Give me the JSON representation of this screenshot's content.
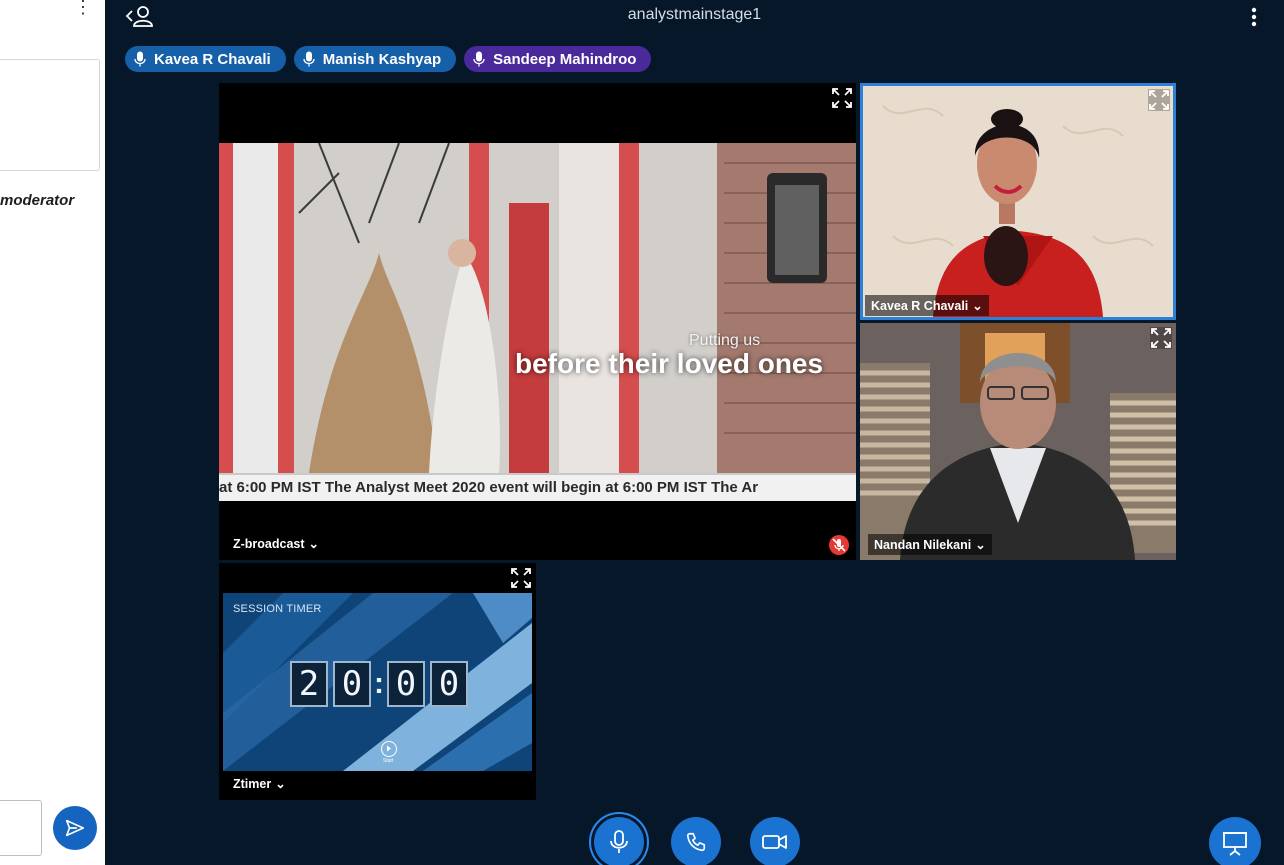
{
  "left_panel": {
    "moderator_text": "moderator",
    "menu_icon": "more-vertical-icon",
    "send_icon": "send-icon"
  },
  "header": {
    "title": "analystmainstage1",
    "back_icon": "back-user-icon",
    "menu_icon": "more-vertical-icon"
  },
  "speakers": [
    {
      "name": "Kavea R Chavali",
      "color": "#1560a8"
    },
    {
      "name": "Manish Kashyap",
      "color": "#1560a8"
    },
    {
      "name": "Sandeep Mahindroo",
      "color": "#4a2a9a"
    }
  ],
  "tiles": {
    "broadcast": {
      "label": "Z-broadcast",
      "overlay_small": "Putting us",
      "overlay_large": "before their loved ones",
      "ticker": "at 6:00 PM IST     The Analyst Meet 2020 event will begin at 6:00 PM IST     The Ar",
      "muted": true
    },
    "kavea": {
      "label": "Kavea R Chavali",
      "active": true
    },
    "nandan": {
      "label": "Nandan Nilekani"
    },
    "timer": {
      "label": "Ztimer",
      "heading": "SESSION TIMER",
      "digits": [
        "2",
        "0",
        "0",
        "0"
      ],
      "start_label": "Start"
    }
  },
  "controls": [
    {
      "name": "microphone",
      "icon": "mic-icon",
      "active": true
    },
    {
      "name": "phone",
      "icon": "phone-icon"
    },
    {
      "name": "camera",
      "icon": "video-icon"
    },
    {
      "name": "present",
      "icon": "presentation-icon"
    }
  ],
  "colors": {
    "background": "#06172a",
    "accent": "#1a73d0",
    "active_border": "#2e7fd6",
    "muted": "#e53935"
  }
}
